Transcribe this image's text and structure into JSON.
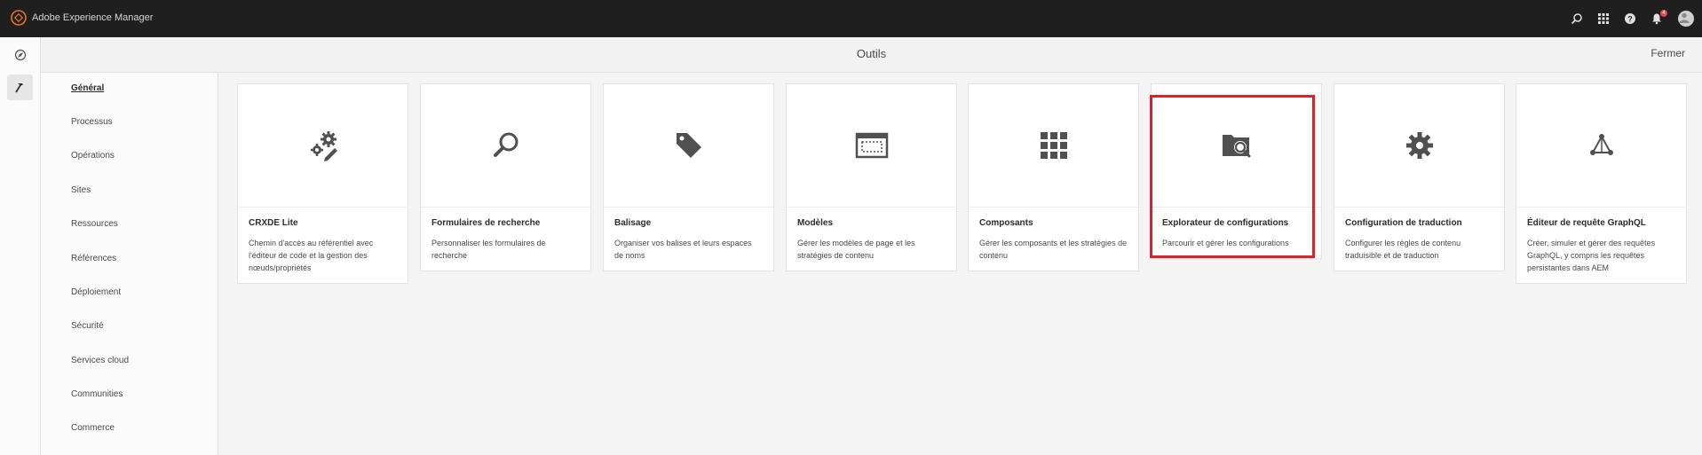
{
  "app": {
    "title": "Adobe Experience Manager",
    "notification_count": "4"
  },
  "header": {
    "title": "Outils",
    "close_label": "Fermer"
  },
  "categories": [
    {
      "label": "Général",
      "active": true
    },
    {
      "label": "Processus"
    },
    {
      "label": "Opérations"
    },
    {
      "label": "Sites"
    },
    {
      "label": "Ressources"
    },
    {
      "label": "Références"
    },
    {
      "label": "Déploiement"
    },
    {
      "label": "Sécurité"
    },
    {
      "label": "Services cloud"
    },
    {
      "label": "Communities"
    },
    {
      "label": "Commerce"
    }
  ],
  "cards": [
    {
      "title": "CRXDE Lite",
      "description": "Chemin d'accès au référentiel avec l'éditeur de code et la gestion des nœuds/propriétés",
      "icon": "gears-edit-icon"
    },
    {
      "title": "Formulaires de recherche",
      "description": "Personnaliser les formulaires de recherche",
      "icon": "search-icon"
    },
    {
      "title": "Balisage",
      "description": "Organiser vos balises et leurs espaces de noms",
      "icon": "tag-icon"
    },
    {
      "title": "Modèles",
      "description": "Gérer les modèles de page et les stratégies de contenu",
      "icon": "template-icon"
    },
    {
      "title": "Composants",
      "description": "Gérer les composants et les stratégies de contenu",
      "icon": "grid-icon"
    },
    {
      "title": "Explorateur de configurations",
      "description": "Parcourir et gérer les configurations",
      "icon": "folder-search-icon"
    },
    {
      "title": "Configuration de traduction",
      "description": "Configurer les règles de contenu traduisible et de traduction",
      "icon": "gear-icon"
    },
    {
      "title": "Éditeur de requête GraphQL",
      "description": "Créer, simuler et gérer des requêtes GraphQL, y compris les requêtes persistantes dans AEM",
      "icon": "graphql-icon"
    }
  ],
  "colors": {
    "topbar": "#1f1f1f",
    "highlight": "#e0212b",
    "icon": "#505050"
  }
}
